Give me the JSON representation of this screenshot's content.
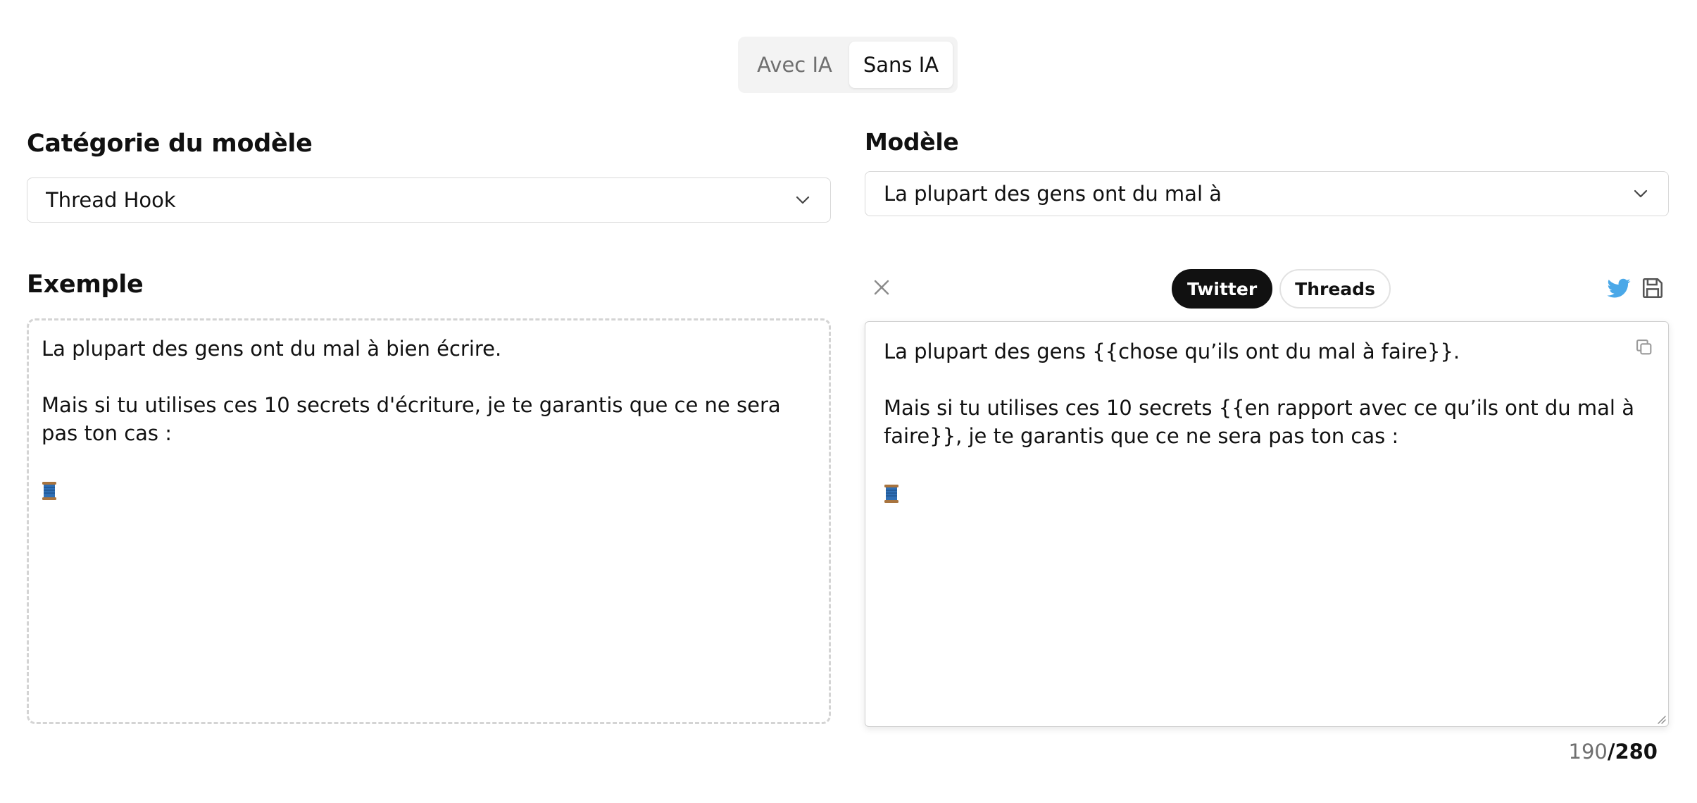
{
  "mode_toggle": {
    "options": [
      "Avec IA",
      "Sans IA"
    ],
    "selected": "Sans IA"
  },
  "category": {
    "title": "Catégorie du modèle",
    "selected": "Thread Hook"
  },
  "model": {
    "title": "Modèle",
    "selected": "La plupart des gens ont du mal à"
  },
  "example": {
    "title": "Exemple",
    "line1": "La plupart des gens ont du mal à bien écrire.",
    "line2": "Mais si tu utilises ces 10 secrets d'écriture, je te garantis que ce ne sera pas ton cas :",
    "emoji": "🧵"
  },
  "editor": {
    "platforms": [
      "Twitter",
      "Threads"
    ],
    "selected_platform": "Twitter",
    "line1": "La plupart des gens {{chose qu’ils ont du mal à faire}}.",
    "line2": "Mais si tu utilises ces 10 secrets {{en rapport avec ce qu’ils ont du mal à faire}}, je te garantis que ce ne sera pas ton cas :",
    "emoji": "🧵"
  },
  "counter": {
    "count": "190",
    "separator": "/",
    "max": "280"
  },
  "icons": {
    "close": "close-icon",
    "twitter": "twitter-icon",
    "save": "save-icon",
    "copy": "copy-icon",
    "chevron": "chevron-down-icon",
    "spool": "thread-spool-emoji"
  },
  "colors": {
    "twitter_blue": "#4aa8e8",
    "active_pill": "#111111",
    "toggle_bg": "#f3f3f3"
  }
}
